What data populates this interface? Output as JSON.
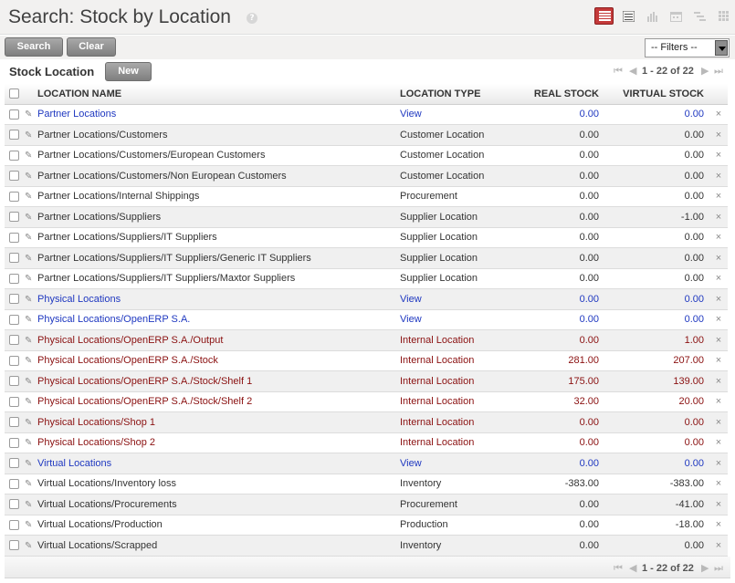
{
  "header": {
    "title": "Search: Stock by Location",
    "help_glyph": "?"
  },
  "search": {
    "search_label": "Search",
    "clear_label": "Clear",
    "filters_label": "-- Filters --"
  },
  "list": {
    "title": "Stock Location",
    "new_label": "New",
    "pager_text": "1 - 22 of 22",
    "columns": {
      "name": "LOCATION NAME",
      "type": "LOCATION TYPE",
      "real": "REAL STOCK",
      "virtual": "VIRTUAL STOCK"
    },
    "row_colors": {
      "blue": "#1f38c0",
      "red": "#8a1010",
      "black": "#333333"
    },
    "rows": [
      {
        "name": "Partner Locations",
        "type": "View",
        "real": "0.00",
        "virtual": "0.00",
        "color": "blue"
      },
      {
        "name": "Partner Locations/Customers",
        "type": "Customer Location",
        "real": "0.00",
        "virtual": "0.00",
        "color": "black"
      },
      {
        "name": "Partner Locations/Customers/European Customers",
        "type": "Customer Location",
        "real": "0.00",
        "virtual": "0.00",
        "color": "black"
      },
      {
        "name": "Partner Locations/Customers/Non European Customers",
        "type": "Customer Location",
        "real": "0.00",
        "virtual": "0.00",
        "color": "black"
      },
      {
        "name": "Partner Locations/Internal Shippings",
        "type": "Procurement",
        "real": "0.00",
        "virtual": "0.00",
        "color": "black"
      },
      {
        "name": "Partner Locations/Suppliers",
        "type": "Supplier Location",
        "real": "0.00",
        "virtual": "-1.00",
        "color": "black"
      },
      {
        "name": "Partner Locations/Suppliers/IT Suppliers",
        "type": "Supplier Location",
        "real": "0.00",
        "virtual": "0.00",
        "color": "black"
      },
      {
        "name": "Partner Locations/Suppliers/IT Suppliers/Generic IT Suppliers",
        "type": "Supplier Location",
        "real": "0.00",
        "virtual": "0.00",
        "color": "black"
      },
      {
        "name": "Partner Locations/Suppliers/IT Suppliers/Maxtor Suppliers",
        "type": "Supplier Location",
        "real": "0.00",
        "virtual": "0.00",
        "color": "black"
      },
      {
        "name": "Physical Locations",
        "type": "View",
        "real": "0.00",
        "virtual": "0.00",
        "color": "blue"
      },
      {
        "name": "Physical Locations/OpenERP S.A.",
        "type": "View",
        "real": "0.00",
        "virtual": "0.00",
        "color": "blue"
      },
      {
        "name": "Physical Locations/OpenERP S.A./Output",
        "type": "Internal Location",
        "real": "0.00",
        "virtual": "1.00",
        "color": "red"
      },
      {
        "name": "Physical Locations/OpenERP S.A./Stock",
        "type": "Internal Location",
        "real": "281.00",
        "virtual": "207.00",
        "color": "red"
      },
      {
        "name": "Physical Locations/OpenERP S.A./Stock/Shelf 1",
        "type": "Internal Location",
        "real": "175.00",
        "virtual": "139.00",
        "color": "red"
      },
      {
        "name": "Physical Locations/OpenERP S.A./Stock/Shelf 2",
        "type": "Internal Location",
        "real": "32.00",
        "virtual": "20.00",
        "color": "red"
      },
      {
        "name": "Physical Locations/Shop 1",
        "type": "Internal Location",
        "real": "0.00",
        "virtual": "0.00",
        "color": "red"
      },
      {
        "name": "Physical Locations/Shop 2",
        "type": "Internal Location",
        "real": "0.00",
        "virtual": "0.00",
        "color": "red"
      },
      {
        "name": "Virtual Locations",
        "type": "View",
        "real": "0.00",
        "virtual": "0.00",
        "color": "blue"
      },
      {
        "name": "Virtual Locations/Inventory loss",
        "type": "Inventory",
        "real": "-383.00",
        "virtual": "-383.00",
        "color": "black"
      },
      {
        "name": "Virtual Locations/Procurements",
        "type": "Procurement",
        "real": "0.00",
        "virtual": "-41.00",
        "color": "black"
      },
      {
        "name": "Virtual Locations/Production",
        "type": "Production",
        "real": "0.00",
        "virtual": "-18.00",
        "color": "black"
      },
      {
        "name": "Virtual Locations/Scrapped",
        "type": "Inventory",
        "real": "0.00",
        "virtual": "0.00",
        "color": "black"
      }
    ]
  },
  "icons": {
    "pencil": "✎",
    "delete": "×",
    "pager_first": "⏮",
    "pager_prev": "◀",
    "pager_next": "▶",
    "pager_last": "⏭"
  }
}
